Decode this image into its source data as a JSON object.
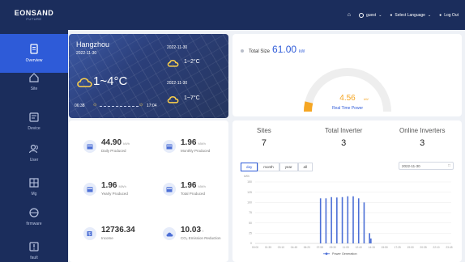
{
  "brand": {
    "name": "EONSAND",
    "sub": "FUTURE"
  },
  "topbar": {
    "user": "guest",
    "language": "Select Language",
    "logout": "Log Out"
  },
  "sidebar": {
    "items": [
      {
        "label": "Overview",
        "icon": "document-icon",
        "active": true
      },
      {
        "label": "Site",
        "icon": "home-icon"
      },
      {
        "label": "Device",
        "icon": "device-icon"
      },
      {
        "label": "User",
        "icon": "users-icon"
      },
      {
        "label": "Mg",
        "icon": "grid-icon"
      },
      {
        "label": "firmware",
        "icon": "layers-icon"
      },
      {
        "label": "fault",
        "icon": "alert-icon"
      }
    ]
  },
  "weather": {
    "city": "Hangzhou",
    "date": "2022-11-30",
    "temp": "1~4°C",
    "sunrise": "06:38",
    "sunset": "17:04",
    "forecast": [
      {
        "date": "2022-11-30",
        "temp": "1~2°C"
      },
      {
        "date": "2022-11-30",
        "temp": "1~7°C"
      }
    ]
  },
  "total": {
    "label": "Total Size",
    "value": "61.00",
    "unit": "kW",
    "power_value": "4.56",
    "power_unit": "kW",
    "power_label": "Real Time Power",
    "power_fraction": 0.075
  },
  "stats": [
    {
      "value": "44.90",
      "unit": "kWh",
      "label": "Daily Produced",
      "icon": "calendar-icon"
    },
    {
      "value": "1.96",
      "unit": "MWh",
      "label": "Monthly Produced",
      "icon": "calendar-icon"
    },
    {
      "value": "1.96",
      "unit": "MWh",
      "label": "Yearly Produced",
      "icon": "calendar-icon"
    },
    {
      "value": "1.96",
      "unit": "MWh",
      "label": "Total Produced",
      "icon": "calendar-icon"
    },
    {
      "value": "12736.34",
      "unit": "",
      "label": "Income",
      "icon": "money-icon"
    },
    {
      "value": "10.03",
      "unit": "t",
      "label": "CO₂ Emission Reduction",
      "icon": "cloud-icon"
    }
  ],
  "kpis": [
    {
      "label": "Sites",
      "value": "7"
    },
    {
      "label": "Total Inverter",
      "value": "3"
    },
    {
      "label": "Online Inverters",
      "value": "3"
    }
  ],
  "tabs": [
    "day",
    "month",
    "year",
    "all"
  ],
  "date_picker": "2022-11-30",
  "colors": {
    "accent": "#2e5bd8",
    "sidebar": "#1b2d5c",
    "gauge": "#f5a623",
    "bar": "#4c6fd6"
  },
  "chart_data": {
    "type": "bar",
    "ylabel": "kWh",
    "ylim": [
      0,
      150
    ],
    "yticks": [
      "150",
      "125",
      "100",
      "75",
      "50",
      "25",
      "0"
    ],
    "xticks": [
      "00:00",
      "01:35",
      "03:10",
      "04:45",
      "06:20",
      "07:55",
      "09:30",
      "11:05",
      "12:40",
      "14:15",
      "15:50",
      "17:25",
      "19:00",
      "20:35",
      "22:10",
      "23:45"
    ],
    "legend": "Power Generation",
    "x": [
      "08:00",
      "08:40",
      "09:20",
      "10:00",
      "10:40",
      "11:20",
      "12:00",
      "12:40",
      "13:20",
      "14:00",
      "14:10"
    ],
    "values": [
      110,
      110,
      113,
      112,
      113,
      115,
      115,
      110,
      100,
      25,
      12
    ]
  }
}
